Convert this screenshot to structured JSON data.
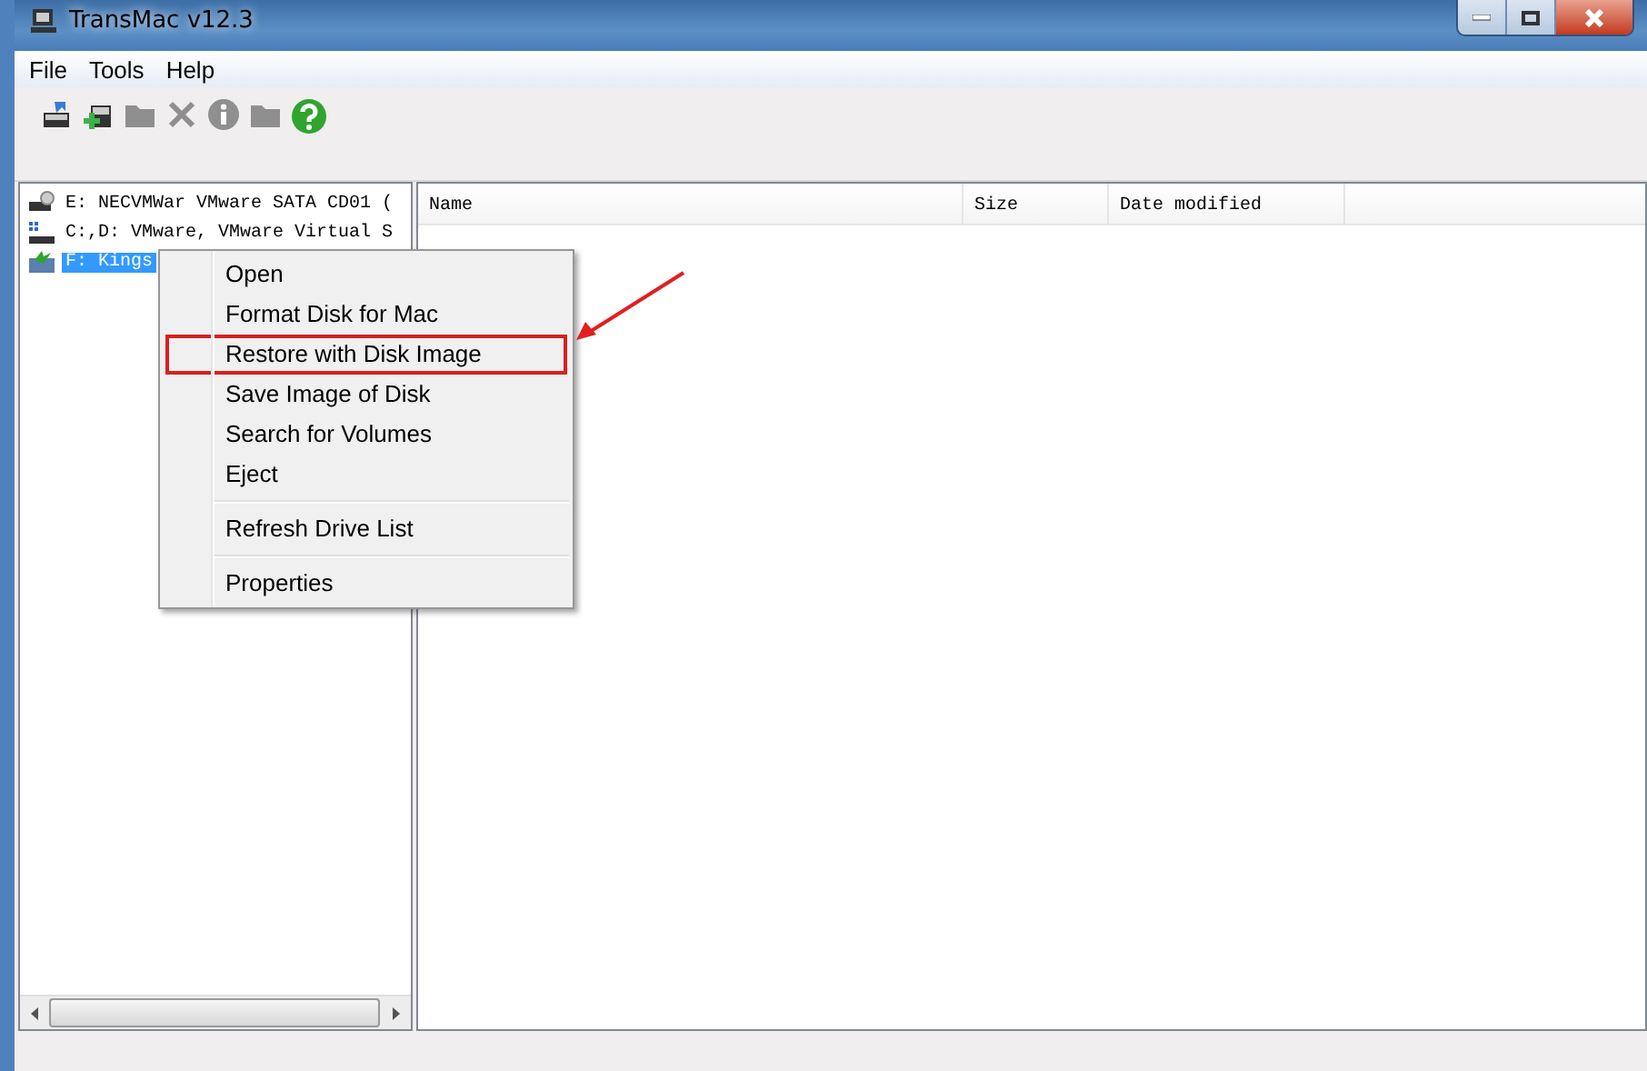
{
  "window": {
    "title": "TransMac v12.3"
  },
  "menu_bar": [
    {
      "label": "File"
    },
    {
      "label": "Tools"
    },
    {
      "label": "Help"
    }
  ],
  "toolbar": [
    {
      "kind": "drive-refresh",
      "disabled": false
    },
    {
      "kind": "drive-add",
      "disabled": false
    },
    {
      "kind": "folder",
      "disabled": true
    },
    {
      "kind": "delete",
      "disabled": true
    },
    {
      "kind": "info",
      "disabled": true
    },
    {
      "kind": "folder",
      "disabled": true
    },
    {
      "kind": "help",
      "disabled": false
    }
  ],
  "drive_tree": [
    {
      "kind": "optical",
      "label": "E:  NECVMWar VMware SATA CD01 (",
      "selected": false
    },
    {
      "kind": "hard-disk",
      "label": "C:,D: VMware, VMware Virtual S",
      "selected": false
    },
    {
      "kind": "usb",
      "label": "F: Kings",
      "selected": true
    }
  ],
  "file_list": {
    "columns": [
      "Name",
      "Size",
      "Date modified"
    ]
  },
  "context_menu": [
    {
      "kind": "item",
      "label": "Open",
      "highlighted": false
    },
    {
      "kind": "item",
      "label": "Format Disk for Mac",
      "highlighted": false
    },
    {
      "kind": "item",
      "label": "Restore with Disk Image",
      "highlighted": true
    },
    {
      "kind": "item",
      "label": "Save Image of Disk",
      "highlighted": false
    },
    {
      "kind": "item",
      "label": "Search for Volumes",
      "highlighted": false
    },
    {
      "kind": "item",
      "label": "Eject",
      "highlighted": false
    },
    {
      "kind": "separator"
    },
    {
      "kind": "item",
      "label": "Refresh Drive List",
      "highlighted": false
    },
    {
      "kind": "separator"
    },
    {
      "kind": "item",
      "label": "Properties",
      "highlighted": false
    }
  ]
}
